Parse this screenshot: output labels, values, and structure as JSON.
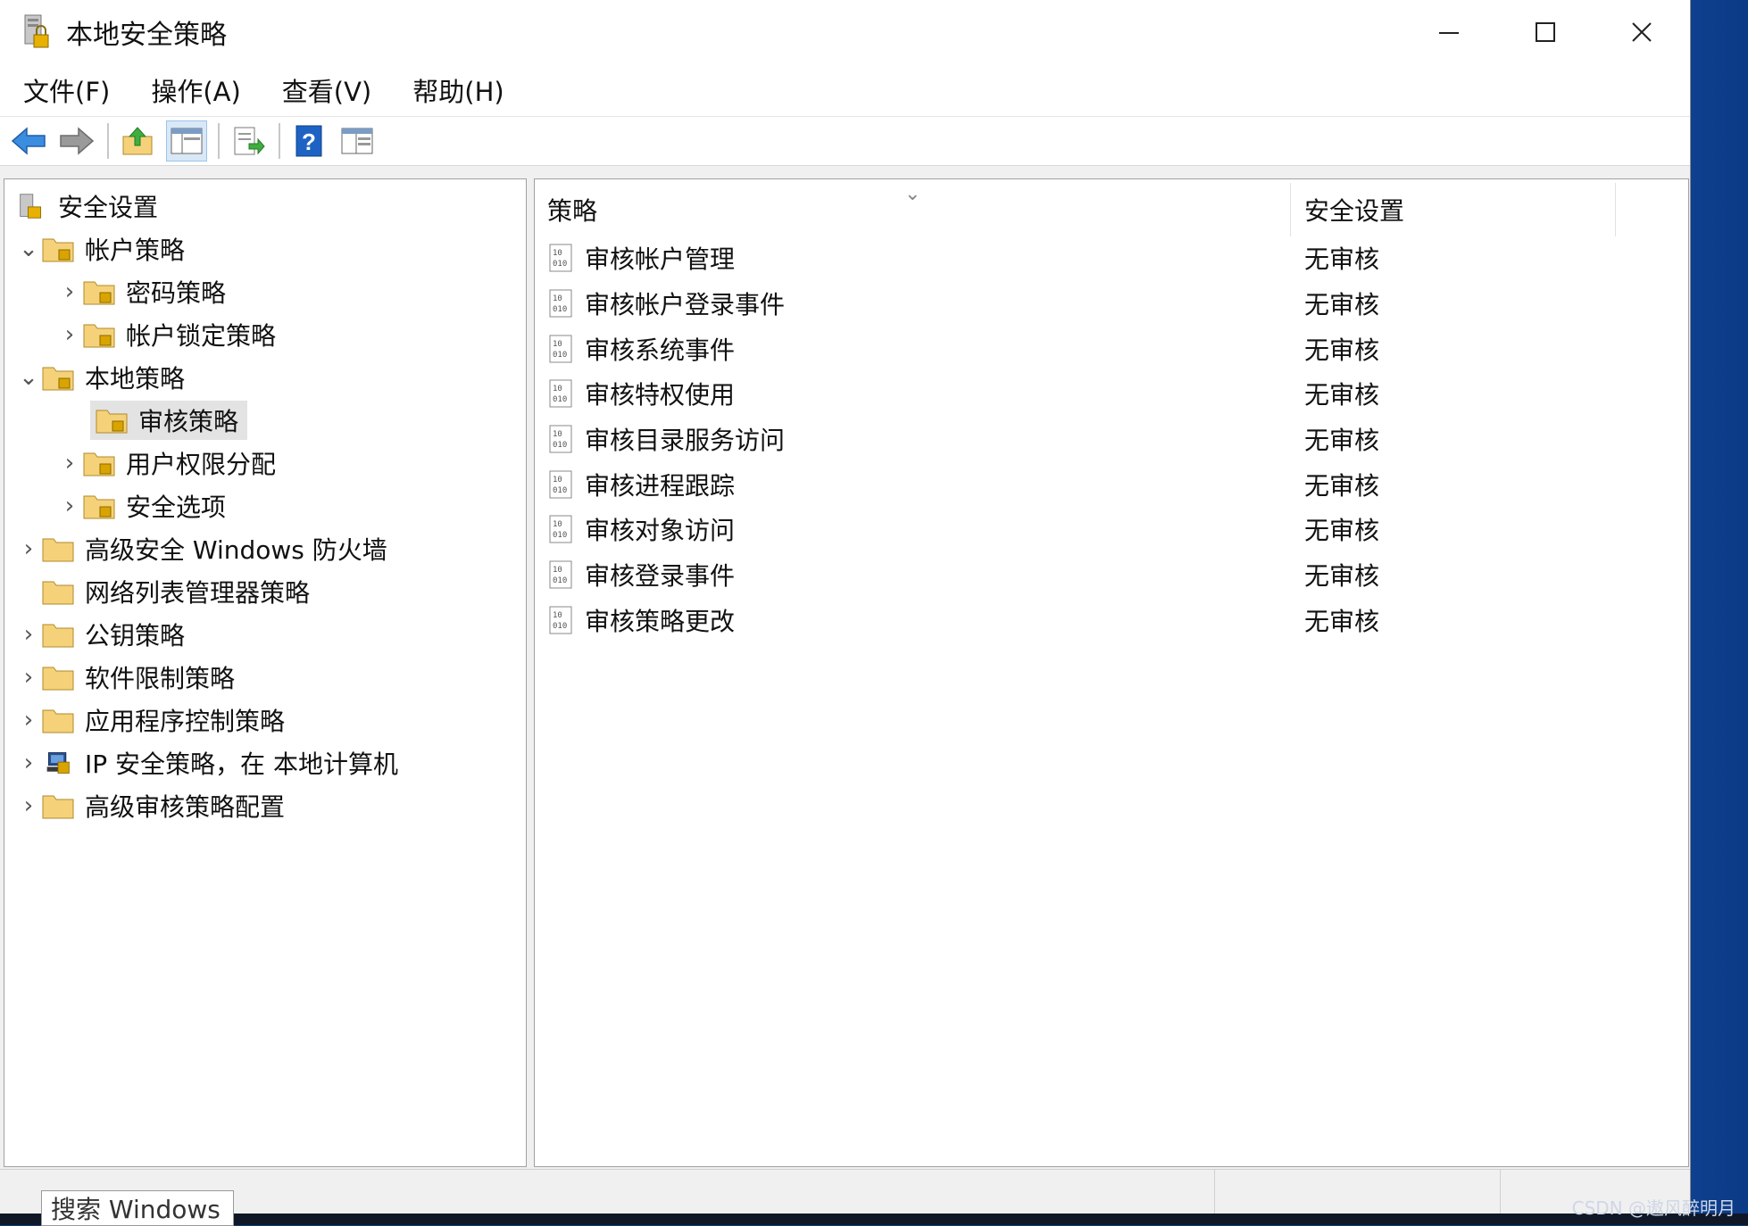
{
  "window": {
    "title": "本地安全策略"
  },
  "menubar": {
    "items": [
      "文件(F)",
      "操作(A)",
      "查看(V)",
      "帮助(H)"
    ]
  },
  "toolbar": {
    "buttons": [
      "back-arrow-icon",
      "forward-arrow-icon",
      "up-folder-icon",
      "show-hide-tree-icon",
      "export-list-icon",
      "help-icon",
      "properties-icon"
    ]
  },
  "tree": {
    "root": "安全设置",
    "items": [
      {
        "label": "帐户策略",
        "expanded": true
      },
      {
        "label": "密码策略"
      },
      {
        "label": "帐户锁定策略"
      },
      {
        "label": "本地策略",
        "expanded": true
      },
      {
        "label": "审核策略",
        "selected": true
      },
      {
        "label": "用户权限分配"
      },
      {
        "label": "安全选项"
      },
      {
        "label": "高级安全 Windows 防火墙"
      },
      {
        "label": "网络列表管理器策略"
      },
      {
        "label": "公钥策略"
      },
      {
        "label": "软件限制策略"
      },
      {
        "label": "应用程序控制策略"
      },
      {
        "label": "IP 安全策略，在 本地计算机"
      },
      {
        "label": "高级审核策略配置"
      }
    ]
  },
  "list": {
    "columns": [
      "策略",
      "安全设置"
    ],
    "rows": [
      {
        "policy": "审核帐户管理",
        "setting": "无审核"
      },
      {
        "policy": "审核帐户登录事件",
        "setting": "无审核"
      },
      {
        "policy": "审核系统事件",
        "setting": "无审核"
      },
      {
        "policy": "审核特权使用",
        "setting": "无审核"
      },
      {
        "policy": "审核目录服务访问",
        "setting": "无审核"
      },
      {
        "policy": "审核进程跟踪",
        "setting": "无审核"
      },
      {
        "policy": "审核对象访问",
        "setting": "无审核"
      },
      {
        "policy": "审核登录事件",
        "setting": "无审核"
      },
      {
        "policy": "审核策略更改",
        "setting": "无审核"
      }
    ]
  },
  "taskbar": {
    "search_placeholder": "搜索 Windows"
  },
  "watermark": "CSDN @遨风醉明月",
  "colors": {
    "folder": "#f5d27a",
    "lock": "#d9a400",
    "selection": "#e3e3e3",
    "help_blue": "#1e63c4"
  }
}
